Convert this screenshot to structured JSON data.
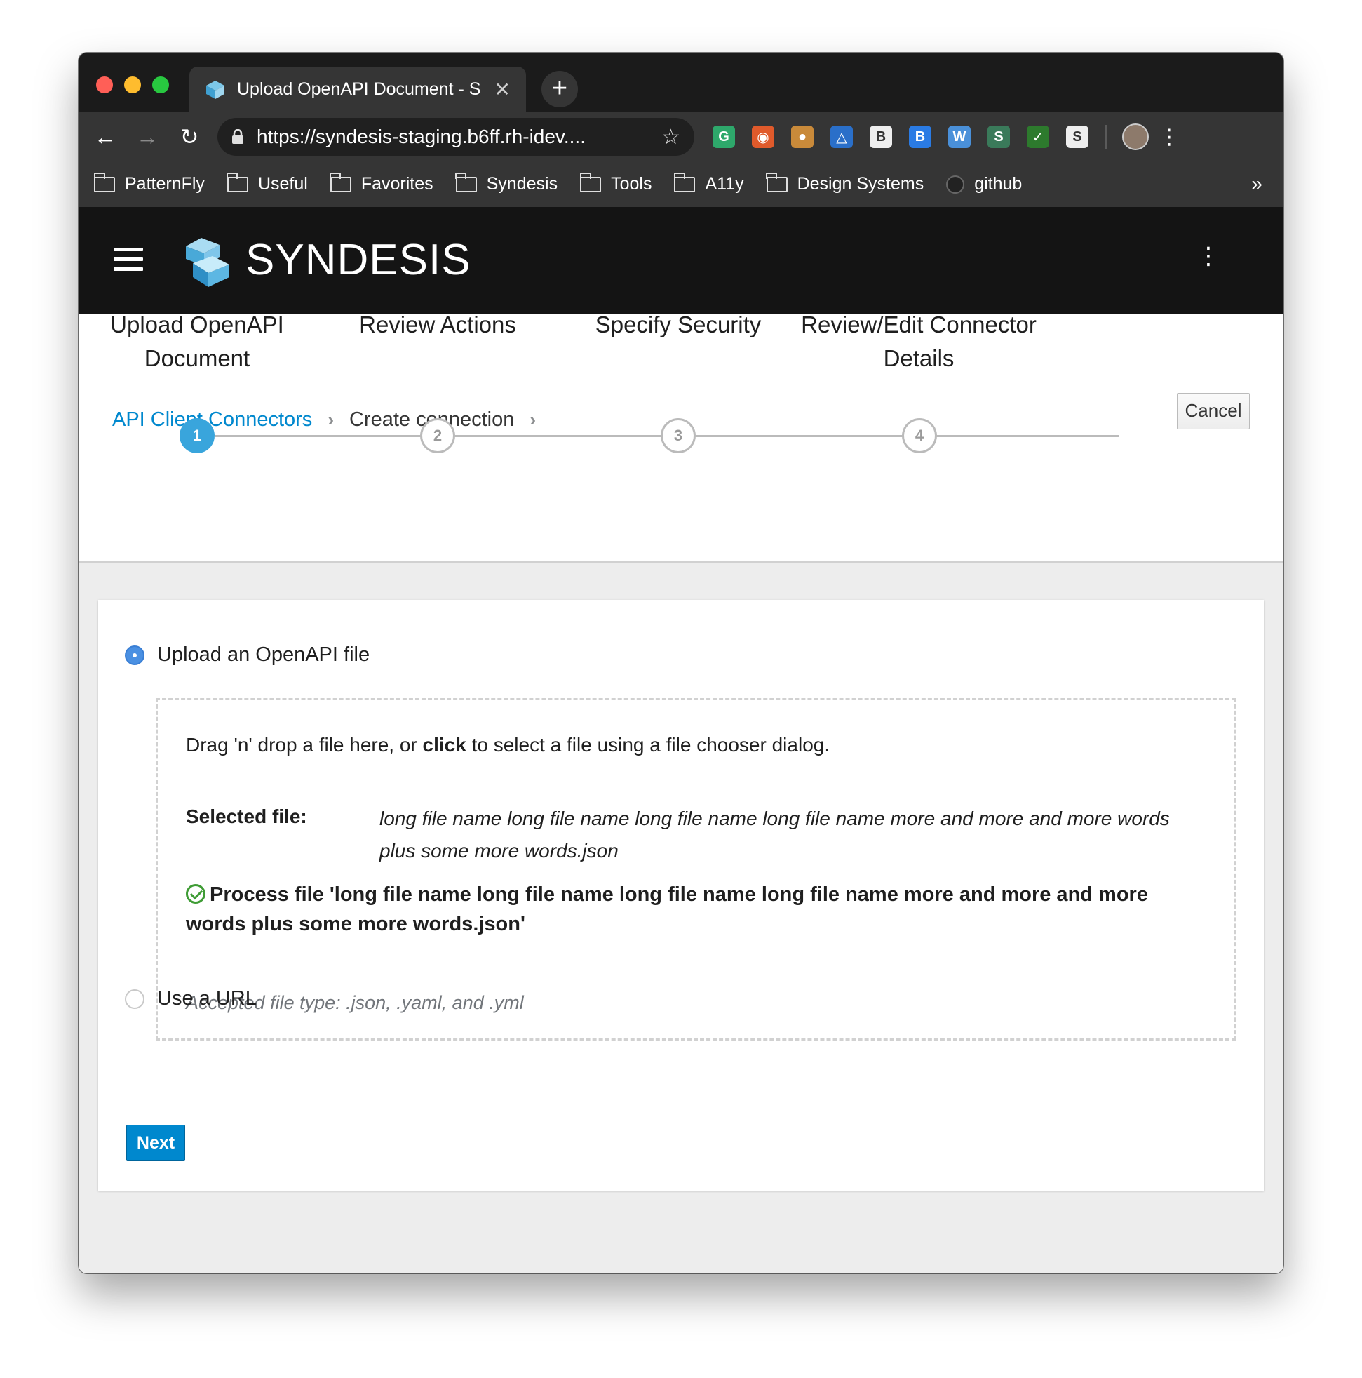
{
  "browser": {
    "tab_title": "Upload OpenAPI Document - S",
    "url": "https://syndesis-staging.b6ff.rh-idev....",
    "extensions": [
      {
        "name": "grammarly-icon",
        "color": "#2ea86b",
        "glyph": "G"
      },
      {
        "name": "color-picker-icon",
        "color": "#e05a2b",
        "glyph": "◉"
      },
      {
        "name": "cookie-icon",
        "color": "#c98a3a",
        "glyph": "●"
      },
      {
        "name": "ax-icon",
        "color": "#2a6fc9",
        "glyph": "△"
      },
      {
        "name": "bi-icon",
        "color": "#eeeeee",
        "glyph": "B"
      },
      {
        "name": "b-video-icon",
        "color": "#2a7be4",
        "glyph": "B"
      },
      {
        "name": "workme-icon",
        "color": "#4a90d9",
        "glyph": "W"
      },
      {
        "name": "s-green-icon",
        "color": "#3a7a5a",
        "glyph": "S"
      },
      {
        "name": "checkmark-ext-icon",
        "color": "#2d7a2d",
        "glyph": "✓"
      },
      {
        "name": "s-white-icon",
        "color": "#eeeeee",
        "glyph": "S"
      }
    ],
    "bookmarks": [
      "PatternFly",
      "Useful",
      "Favorites",
      "Syndesis",
      "Tools",
      "A11y",
      "Design Systems"
    ],
    "github_bookmark": "github",
    "more": "»"
  },
  "app": {
    "brand": "SYNDESIS"
  },
  "breadcrumb": {
    "link": "API Client Connectors",
    "current": "Create connection",
    "cancel": "Cancel"
  },
  "wizard": {
    "steps": [
      {
        "label": "Upload OpenAPI Document",
        "number": "1",
        "active": true
      },
      {
        "label": "Review Actions",
        "number": "2",
        "active": false
      },
      {
        "label": "Specify Security",
        "number": "3",
        "active": false
      },
      {
        "label": "Review/Edit Connector Details",
        "number": "4",
        "active": false
      }
    ]
  },
  "form": {
    "upload_option": "Upload an OpenAPI file",
    "drop_prefix": "Drag 'n' drop a file here, or ",
    "drop_click": "click",
    "drop_suffix": " to select a file using a file chooser dialog.",
    "selected_label": "Selected file:",
    "selected_file": "long file name long file name long file name long file name more and more and more words plus some more words.json",
    "process_message": "Process file 'long file name long file name long file name long file name more and more and more words plus some more words.json'",
    "accepted_types": "Accepted file type: .json, .yaml, and .yml",
    "url_option": "Use a URL",
    "next": "Next"
  }
}
